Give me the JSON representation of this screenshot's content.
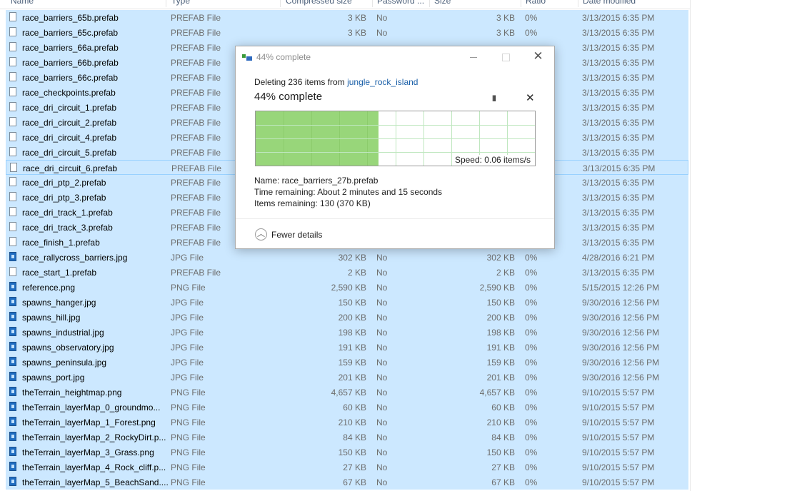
{
  "columns": {
    "name": "Name",
    "type": "Type",
    "compressed": "Compressed size",
    "password": "Password ...",
    "size": "Size",
    "ratio": "Ratio",
    "date": "Date modified"
  },
  "files": [
    {
      "name": "race_barriers_65b.prefab",
      "type": "PREFAB File",
      "compressed": "3 KB",
      "password": "No",
      "size": "3 KB",
      "ratio": "0%",
      "date": "3/13/2015 6:35 PM",
      "icon": "file-icon"
    },
    {
      "name": "race_barriers_65c.prefab",
      "type": "PREFAB File",
      "compressed": "3 KB",
      "password": "No",
      "size": "3 KB",
      "ratio": "0%",
      "date": "3/13/2015 6:35 PM",
      "icon": "file-icon"
    },
    {
      "name": "race_barriers_66a.prefab",
      "type": "PREFAB File",
      "compressed": "",
      "password": "",
      "size": "",
      "ratio": "",
      "date": "3/13/2015 6:35 PM",
      "icon": "file-icon"
    },
    {
      "name": "race_barriers_66b.prefab",
      "type": "PREFAB File",
      "compressed": "",
      "password": "",
      "size": "",
      "ratio": "",
      "date": "3/13/2015 6:35 PM",
      "icon": "file-icon"
    },
    {
      "name": "race_barriers_66c.prefab",
      "type": "PREFAB File",
      "compressed": "",
      "password": "",
      "size": "",
      "ratio": "",
      "date": "3/13/2015 6:35 PM",
      "icon": "file-icon"
    },
    {
      "name": "race_checkpoints.prefab",
      "type": "PREFAB File",
      "compressed": "",
      "password": "",
      "size": "",
      "ratio": "",
      "date": "3/13/2015 6:35 PM",
      "icon": "file-icon"
    },
    {
      "name": "race_dri_circuit_1.prefab",
      "type": "PREFAB File",
      "compressed": "",
      "password": "",
      "size": "",
      "ratio": "",
      "date": "3/13/2015 6:35 PM",
      "icon": "file-icon"
    },
    {
      "name": "race_dri_circuit_2.prefab",
      "type": "PREFAB File",
      "compressed": "",
      "password": "",
      "size": "",
      "ratio": "",
      "date": "3/13/2015 6:35 PM",
      "icon": "file-icon"
    },
    {
      "name": "race_dri_circuit_4.prefab",
      "type": "PREFAB File",
      "compressed": "",
      "password": "",
      "size": "",
      "ratio": "",
      "date": "3/13/2015 6:35 PM",
      "icon": "file-icon"
    },
    {
      "name": "race_dri_circuit_5.prefab",
      "type": "PREFAB File",
      "compressed": "",
      "password": "",
      "size": "",
      "ratio": "",
      "date": "3/13/2015 6:35 PM",
      "icon": "file-icon"
    },
    {
      "name": "race_dri_circuit_6.prefab",
      "type": "PREFAB File",
      "compressed": "",
      "password": "",
      "size": "",
      "ratio": "",
      "date": "3/13/2015 6:35 PM",
      "icon": "file-icon",
      "focused": true
    },
    {
      "name": "race_dri_ptp_2.prefab",
      "type": "PREFAB File",
      "compressed": "",
      "password": "",
      "size": "",
      "ratio": "",
      "date": "3/13/2015 6:35 PM",
      "icon": "file-icon"
    },
    {
      "name": "race_dri_ptp_3.prefab",
      "type": "PREFAB File",
      "compressed": "",
      "password": "",
      "size": "",
      "ratio": "",
      "date": "3/13/2015 6:35 PM",
      "icon": "file-icon"
    },
    {
      "name": "race_dri_track_1.prefab",
      "type": "PREFAB File",
      "compressed": "",
      "password": "",
      "size": "",
      "ratio": "",
      "date": "3/13/2015 6:35 PM",
      "icon": "file-icon"
    },
    {
      "name": "race_dri_track_3.prefab",
      "type": "PREFAB File",
      "compressed": "",
      "password": "",
      "size": "",
      "ratio": "",
      "date": "3/13/2015 6:35 PM",
      "icon": "file-icon"
    },
    {
      "name": "race_finish_1.prefab",
      "type": "PREFAB File",
      "compressed": "",
      "password": "",
      "size": "",
      "ratio": "",
      "date": "3/13/2015 6:35 PM",
      "icon": "file-icon"
    },
    {
      "name": "race_rallycross_barriers.jpg",
      "type": "JPG File",
      "compressed": "302 KB",
      "password": "No",
      "size": "302 KB",
      "ratio": "0%",
      "date": "4/28/2016 6:21 PM",
      "icon": "image-icon"
    },
    {
      "name": "race_start_1.prefab",
      "type": "PREFAB File",
      "compressed": "2 KB",
      "password": "No",
      "size": "2 KB",
      "ratio": "0%",
      "date": "3/13/2015 6:35 PM",
      "icon": "file-icon"
    },
    {
      "name": "reference.png",
      "type": "PNG File",
      "compressed": "2,590 KB",
      "password": "No",
      "size": "2,590 KB",
      "ratio": "0%",
      "date": "5/15/2015 12:26 PM",
      "icon": "image-icon"
    },
    {
      "name": "spawns_hanger.jpg",
      "type": "JPG File",
      "compressed": "150 KB",
      "password": "No",
      "size": "150 KB",
      "ratio": "0%",
      "date": "9/30/2016 12:56 PM",
      "icon": "image-icon"
    },
    {
      "name": "spawns_hill.jpg",
      "type": "JPG File",
      "compressed": "200 KB",
      "password": "No",
      "size": "200 KB",
      "ratio": "0%",
      "date": "9/30/2016 12:56 PM",
      "icon": "image-icon"
    },
    {
      "name": "spawns_industrial.jpg",
      "type": "JPG File",
      "compressed": "198 KB",
      "password": "No",
      "size": "198 KB",
      "ratio": "0%",
      "date": "9/30/2016 12:56 PM",
      "icon": "image-icon"
    },
    {
      "name": "spawns_observatory.jpg",
      "type": "JPG File",
      "compressed": "191 KB",
      "password": "No",
      "size": "191 KB",
      "ratio": "0%",
      "date": "9/30/2016 12:56 PM",
      "icon": "image-icon"
    },
    {
      "name": "spawns_peninsula.jpg",
      "type": "JPG File",
      "compressed": "159 KB",
      "password": "No",
      "size": "159 KB",
      "ratio": "0%",
      "date": "9/30/2016 12:56 PM",
      "icon": "image-icon"
    },
    {
      "name": "spawns_port.jpg",
      "type": "JPG File",
      "compressed": "201 KB",
      "password": "No",
      "size": "201 KB",
      "ratio": "0%",
      "date": "9/30/2016 12:56 PM",
      "icon": "image-icon"
    },
    {
      "name": "theTerrain_heightmap.png",
      "type": "PNG File",
      "compressed": "4,657 KB",
      "password": "No",
      "size": "4,657 KB",
      "ratio": "0%",
      "date": "9/10/2015 5:57 PM",
      "icon": "image-icon"
    },
    {
      "name": "theTerrain_layerMap_0_groundmo...",
      "type": "PNG File",
      "compressed": "60 KB",
      "password": "No",
      "size": "60 KB",
      "ratio": "0%",
      "date": "9/10/2015 5:57 PM",
      "icon": "image-icon"
    },
    {
      "name": "theTerrain_layerMap_1_Forest.png",
      "type": "PNG File",
      "compressed": "210 KB",
      "password": "No",
      "size": "210 KB",
      "ratio": "0%",
      "date": "9/10/2015 5:57 PM",
      "icon": "image-icon"
    },
    {
      "name": "theTerrain_layerMap_2_RockyDirt.p...",
      "type": "PNG File",
      "compressed": "84 KB",
      "password": "No",
      "size": "84 KB",
      "ratio": "0%",
      "date": "9/10/2015 5:57 PM",
      "icon": "image-icon"
    },
    {
      "name": "theTerrain_layerMap_3_Grass.png",
      "type": "PNG File",
      "compressed": "150 KB",
      "password": "No",
      "size": "150 KB",
      "ratio": "0%",
      "date": "9/10/2015 5:57 PM",
      "icon": "image-icon"
    },
    {
      "name": "theTerrain_layerMap_4_Rock_cliff.p...",
      "type": "PNG File",
      "compressed": "27 KB",
      "password": "No",
      "size": "27 KB",
      "ratio": "0%",
      "date": "9/10/2015 5:57 PM",
      "icon": "image-icon"
    },
    {
      "name": "theTerrain_layerMap_5_BeachSand....",
      "type": "PNG File",
      "compressed": "67 KB",
      "password": "No",
      "size": "67 KB",
      "ratio": "0%",
      "date": "9/10/2015 5:57 PM",
      "icon": "image-icon"
    }
  ],
  "dialog": {
    "title": "44% complete",
    "deleting_prefix": "Deleting 236 items from ",
    "deleting_source": "jungle_rock_island",
    "percent_label": "44% complete",
    "progress_fraction": 0.44,
    "pause_symbol": "II",
    "cancel_symbol": "✕",
    "speed": "Speed: 0.06 items/s",
    "name_line": "Name:  race_barriers_27b.prefab",
    "time_line": "Time remaining:  About 2 minutes and 15 seconds",
    "items_line": "Items remaining:  130 (370 KB)",
    "fewer_details": "Fewer details",
    "window_buttons": {
      "minimize": "–",
      "maximize": "☐",
      "close": "✕"
    }
  },
  "colors": {
    "selection": "#cce8ff",
    "progress_fill": "#98d67a",
    "link": "#1a5fa8"
  }
}
